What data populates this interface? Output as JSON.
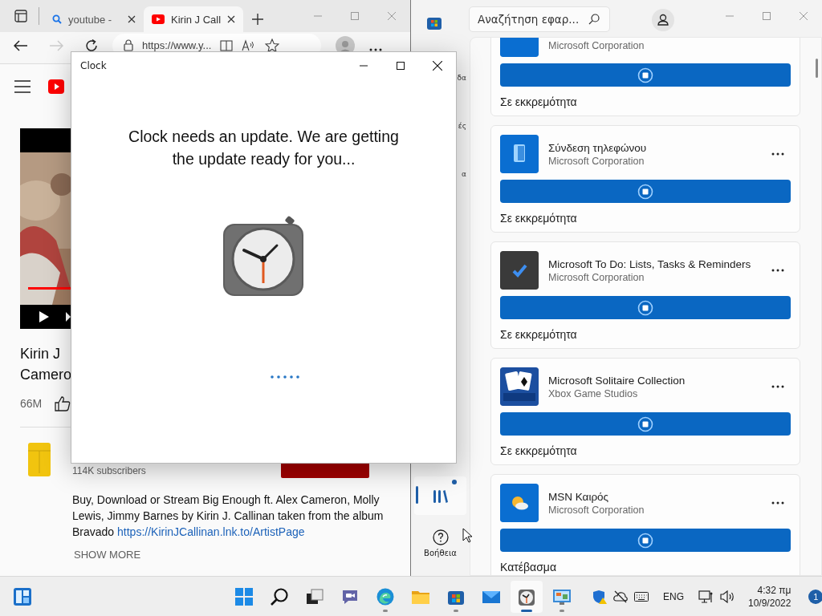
{
  "browser": {
    "tabs": [
      {
        "label": "youtube -",
        "selected": false
      },
      {
        "label": "Kirin J Call",
        "selected": true
      }
    ],
    "forward": {
      "disabled": true
    },
    "address": "https://www.y...",
    "video": {
      "title_lines": [
        "Kirin J",
        "Camero"
      ],
      "views": "66M",
      "subscribers": "114K subscribers",
      "description": "Buy, Download or Stream Big Enough ft. Alex Cameron, Molly Lewis, Jimmy Barnes by Kirin J. Callinan taken from the album Bravado ",
      "link": "https://KirinJCallinan.lnk.to/ArtistPage",
      "show_more": "SHOW MORE"
    }
  },
  "store": {
    "search": {
      "placeholder": "Αναζήτηση εφαρ..."
    },
    "sidebar": {
      "items": [
        {
          "label": "δα"
        },
        {
          "label": "ές"
        },
        {
          "label": "α"
        }
      ],
      "library": {
        "selected": true
      },
      "help": "Βοήθεια"
    },
    "apps": [
      {
        "publisher": "Microsoft Corporation",
        "status": "Σε εκκρεμότητα"
      },
      {
        "name": "Σύνδεση τηλεφώνου",
        "publisher": "Microsoft Corporation",
        "status": "Σε εκκρεμότητα"
      },
      {
        "name": "Microsoft To Do: Lists, Tasks & Reminders",
        "publisher": "Microsoft Corporation",
        "status": "Σε εκκρεμότητα"
      },
      {
        "name": "Microsoft Solitaire Collection",
        "publisher": "Xbox Game Studios",
        "status": "Σε εκκρεμότητα"
      },
      {
        "name": "MSN Καιρός",
        "publisher": "Microsoft Corporation",
        "status": "Κατέβασμα"
      }
    ]
  },
  "clock_dialog": {
    "title": "Clock",
    "message": "Clock needs an update. We are getting the update ready for you..."
  },
  "taskbar": {
    "apps": [
      {
        "running": false,
        "selected": false
      },
      {
        "running": false,
        "selected": false
      },
      {
        "running": false,
        "selected": false
      },
      {
        "running": false,
        "selected": false
      },
      {
        "running": true,
        "selected": false
      },
      {
        "running": false,
        "selected": false
      },
      {
        "running": true,
        "selected": false
      },
      {
        "running": false,
        "selected": false
      },
      {
        "running": true,
        "selected": true
      },
      {
        "running": true,
        "selected": false
      }
    ],
    "language": "ENG",
    "time": "4:32 πμ",
    "date": "10/9/2022",
    "notifications": "1"
  }
}
